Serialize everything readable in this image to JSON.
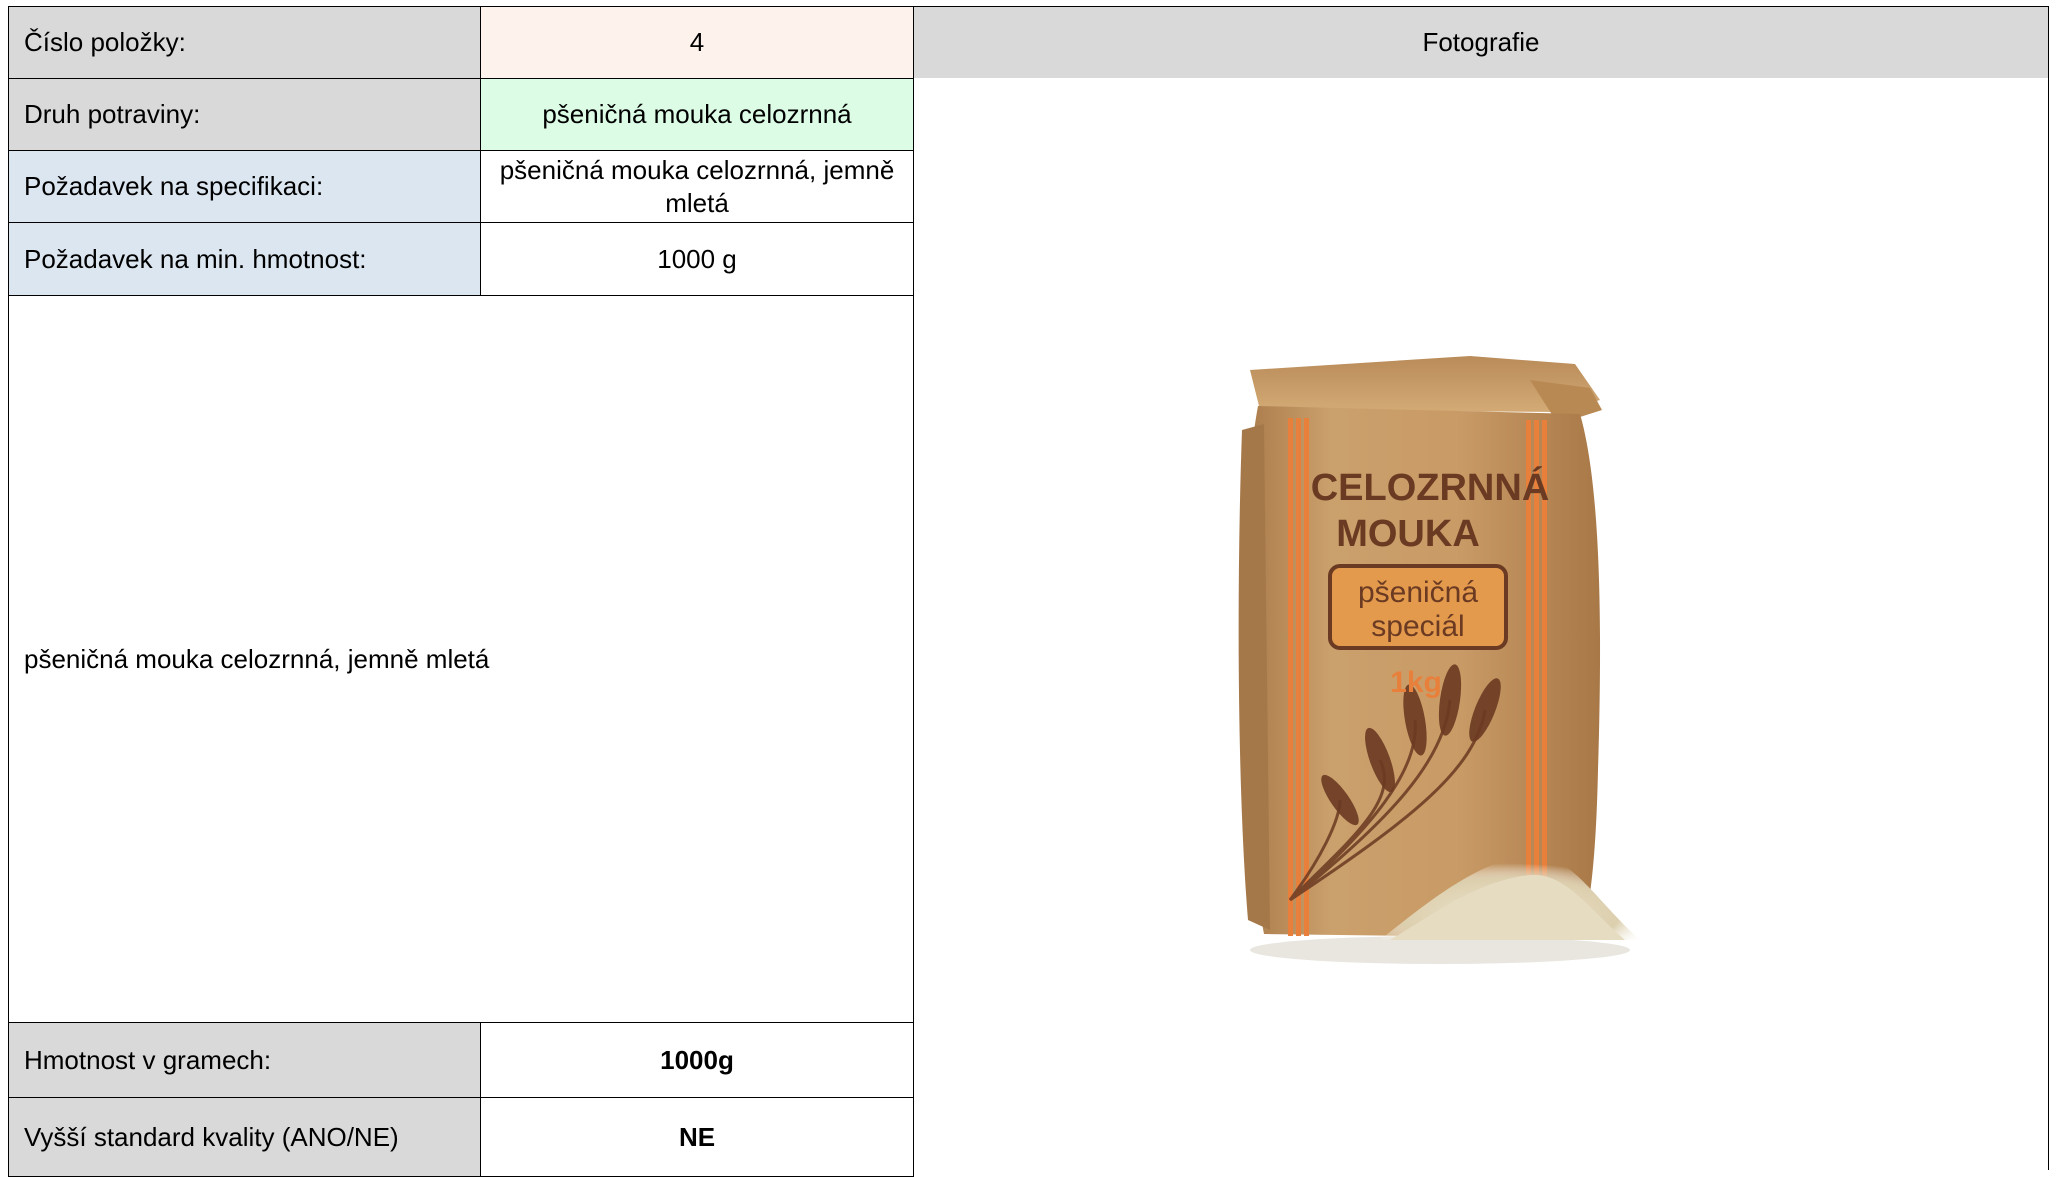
{
  "table": {
    "item_number_label": "Číslo položky:",
    "item_number_value": "4",
    "photo_header": "Fotografie",
    "food_type_label": "Druh potraviny:",
    "food_type_value": "pšeničná mouka celozrnná",
    "spec_requirement_label": "Požadavek na specifikaci:",
    "spec_requirement_value": "pšeničná mouka celozrnná, jemně mletá",
    "min_weight_label": "Požadavek na min. hmotnost:",
    "min_weight_value": "1000 g",
    "description_text": "pšeničná mouka celozrnná, jemně mletá",
    "weight_grams_label": "Hmotnost v gramech:",
    "weight_grams_value": "1000g",
    "quality_label": "Vyšší standard kvality (ANO/NE)",
    "quality_value": "NE"
  },
  "photo": {
    "package_title_line1": "CELOZRNNÁ",
    "package_title_line2": "MOUKA",
    "package_badge_line1": "pšeničná",
    "package_badge_line2": "speciál",
    "package_weight": "1kg"
  },
  "colors": {
    "header_gray": "#d9d9d9",
    "label_blue": "#dce6f1",
    "value_peach": "#fdf2ec",
    "value_mint": "#dcfce6",
    "bag_kraft": "#c89a63",
    "bag_print": "#6b3a22",
    "bag_stripe": "#e8803c"
  }
}
